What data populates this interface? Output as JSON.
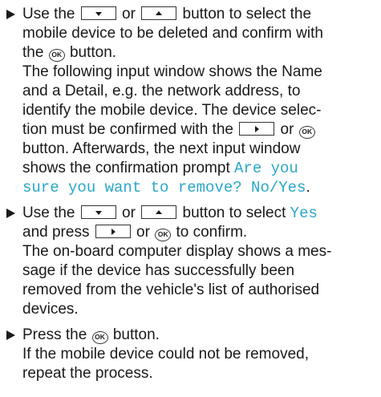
{
  "steps": [
    {
      "l1_a": "Use the",
      "l1_b": "or",
      "l1_c": "button to select the",
      "l2": "mobile device to be deleted and confirm with",
      "l3_a": "the",
      "l3_b": "button.",
      "p2_l1": "The following input window shows the Name",
      "p2_l2": "and a Detail, e.g. the network address, to",
      "p2_l3": "identify the mobile device. The device selec-",
      "p2_l4_a": "tion must be confirmed with the",
      "p2_l4_b": "or",
      "p2_l5": "button. Afterwards, the next input window",
      "p2_l6_a": "shows the confirmation prompt",
      "p2_l6_b": "Are you",
      "p2_l7_a": "sure you want to remove? No/Yes",
      "p2_l7_b": "."
    },
    {
      "l1_a": "Use the",
      "l1_b": "or",
      "l1_c": "button to select",
      "l1_d": "Yes",
      "l2_a": "and press",
      "l2_b": "or",
      "l2_c": "to confirm.",
      "p2_l1": "The on-board computer display shows a mes-",
      "p2_l2": "sage if the device has successfully been",
      "p2_l3": "removed from the vehicle's list of authorised",
      "p2_l4": "devices."
    },
    {
      "l1_a": "Press the",
      "l1_b": "button.",
      "p2_l1": "If the mobile device could not be removed,",
      "p2_l2": "repeat the process."
    }
  ],
  "buttons": {
    "ok_label": "OK"
  },
  "colors": {
    "display_text": "#2aa7c9"
  },
  "icons": [
    "step-arrow-icon",
    "down-button-icon",
    "up-button-icon",
    "right-button-icon",
    "ok-button-icon"
  ]
}
